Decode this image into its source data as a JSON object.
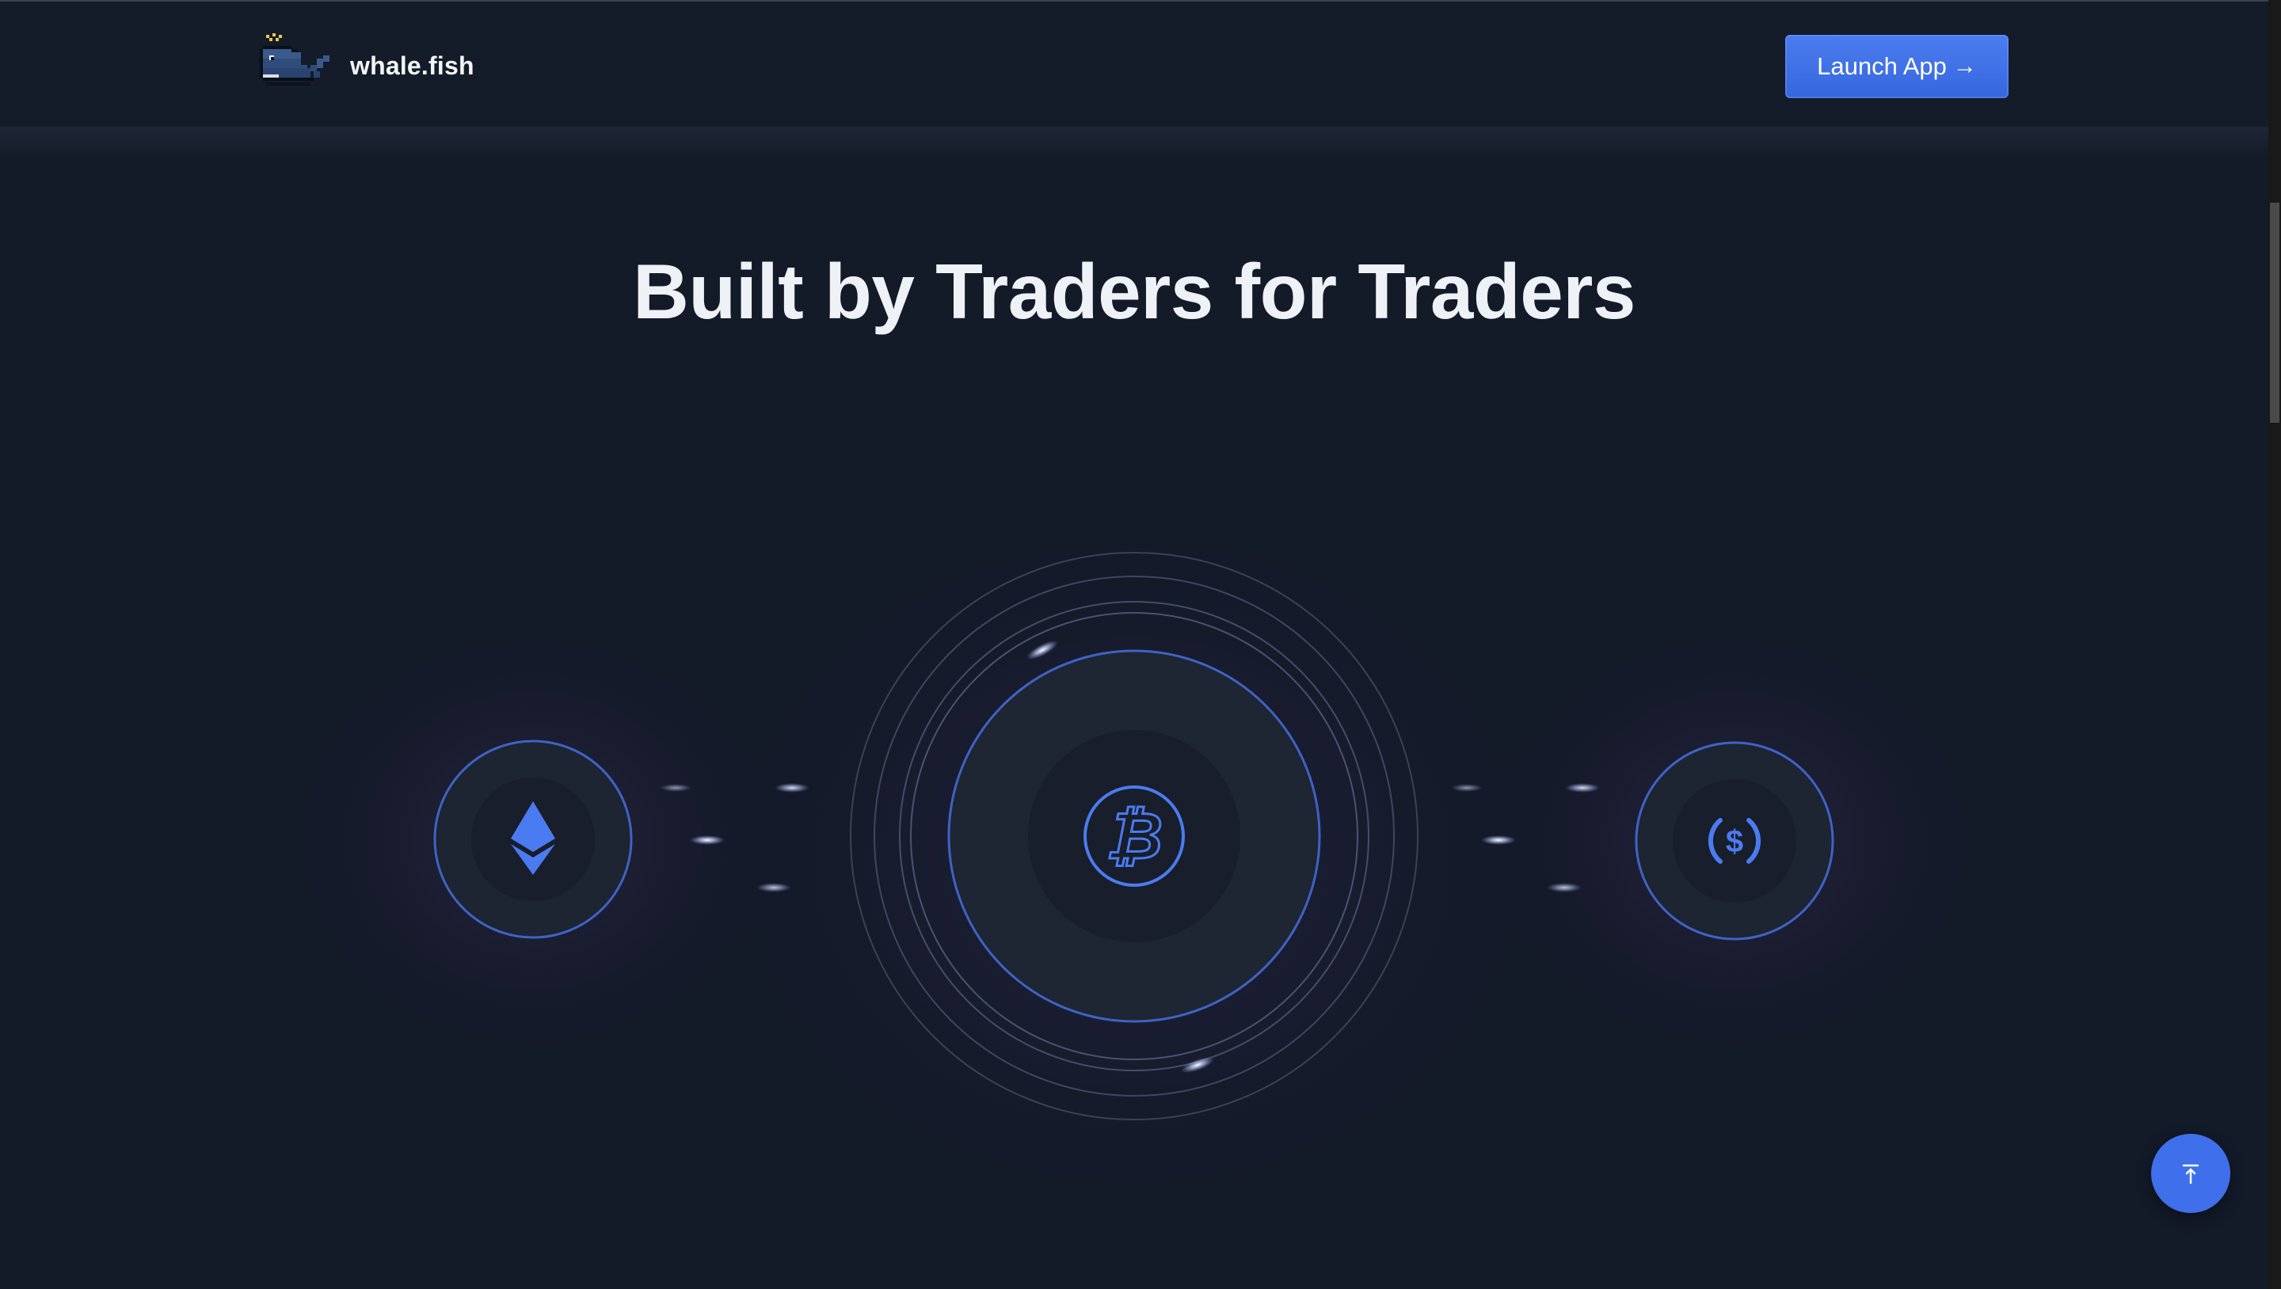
{
  "header": {
    "brand_name": "whale.fish",
    "launch_label": "Launch App",
    "launch_arrow": "→"
  },
  "hero": {
    "title": "Built by Traders for Traders"
  },
  "illustration": {
    "tokens": [
      {
        "icon": "ethereum-icon"
      },
      {
        "icon": "bitcoin-icon"
      },
      {
        "icon": "usd-coin-icon"
      }
    ]
  },
  "colors": {
    "background": "#131a28",
    "accent": "#3f6fea",
    "icon_blue": "#4b7bf0",
    "text": "#eef1f6"
  }
}
